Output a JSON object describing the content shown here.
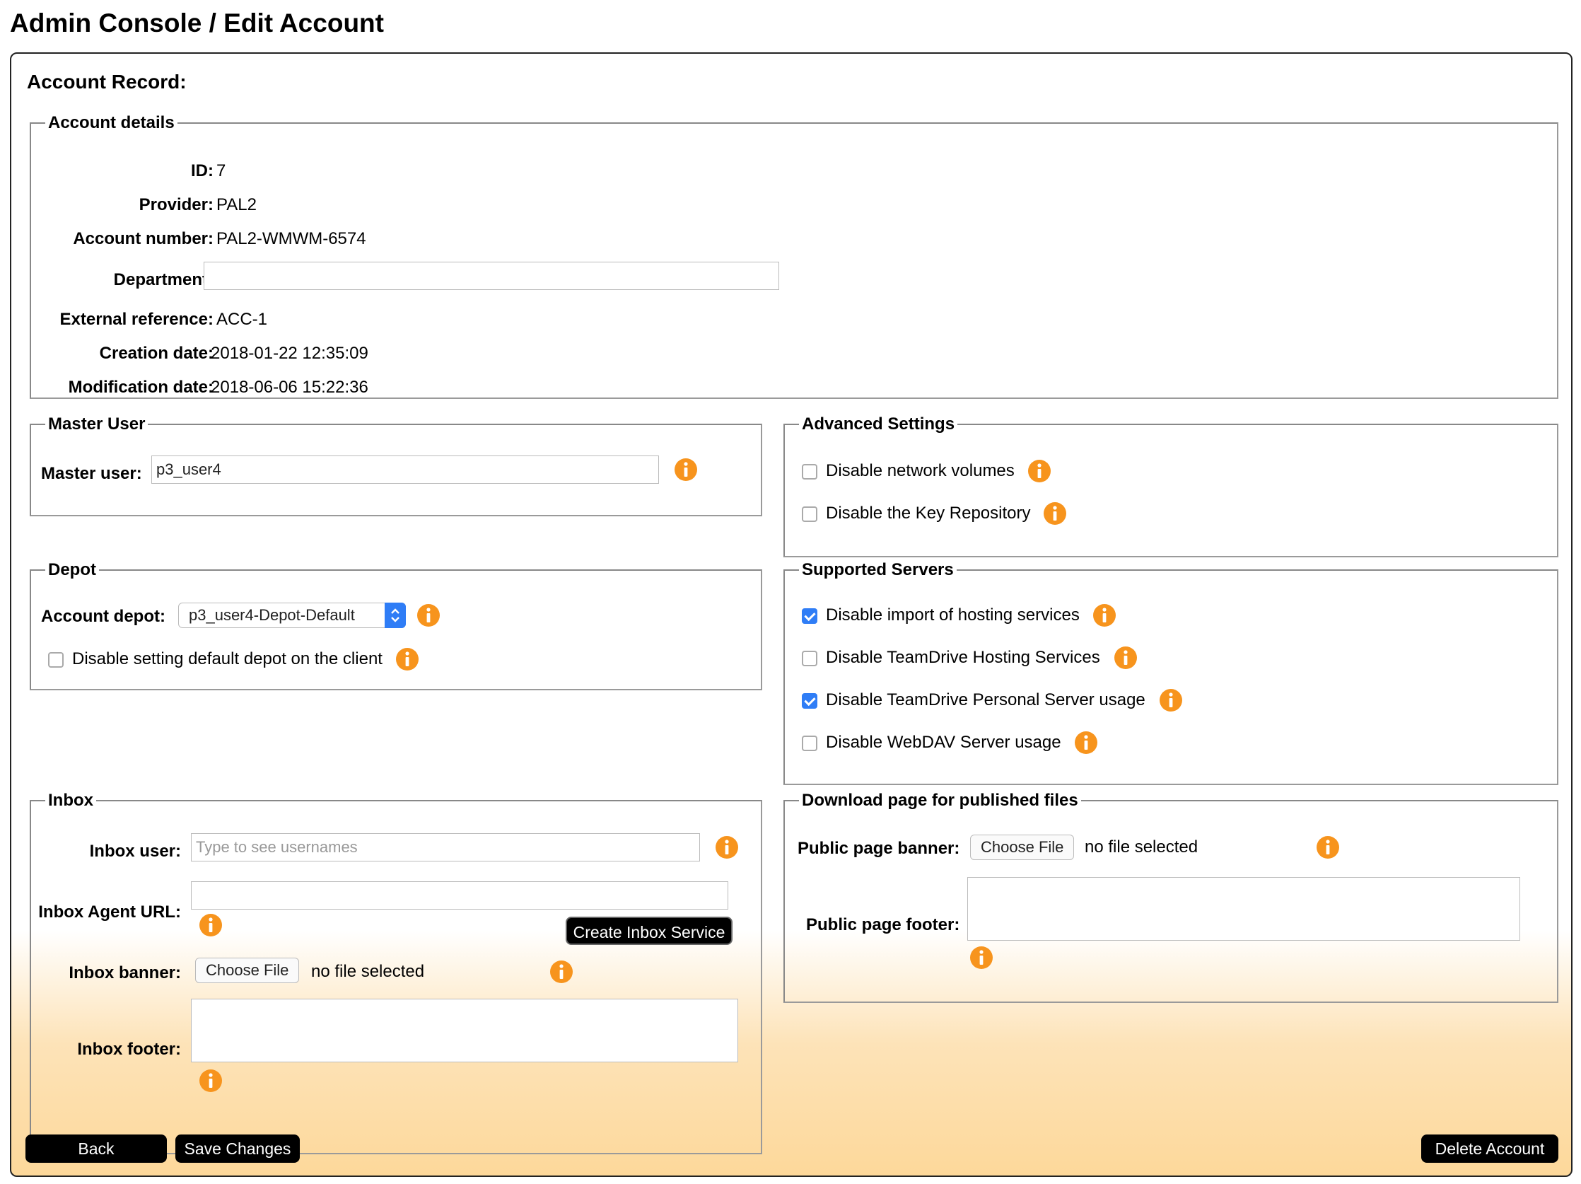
{
  "page": {
    "title": "Admin Console / Edit Account",
    "section_title": "Account Record:"
  },
  "account_details": {
    "legend": "Account details",
    "id_label": "ID:",
    "id": "7",
    "provider_label": "Provider:",
    "provider": "PAL2",
    "account_number_label": "Account number:",
    "account_number": "PAL2-WMWM-6574",
    "department_label": "Department:",
    "department": "",
    "external_reference_label": "External reference:",
    "external_reference": "ACC-1",
    "creation_date_label": "Creation date:",
    "creation_date": "2018-01-22 12:35:09",
    "modification_date_label": "Modification date:",
    "modification_date": "2018-06-06 15:22:36"
  },
  "master_user": {
    "legend": "Master User",
    "label": "Master user:",
    "value": "p3_user4"
  },
  "advanced_settings": {
    "legend": "Advanced Settings",
    "items": [
      {
        "label": "Disable network volumes",
        "checked": false
      },
      {
        "label": "Disable the Key Repository",
        "checked": false
      }
    ]
  },
  "depot": {
    "legend": "Depot",
    "label": "Account depot:",
    "selected": "p3_user4-Depot-Default",
    "checkbox_label": "Disable setting default depot on the client",
    "checkbox_checked": false
  },
  "supported_servers": {
    "legend": "Supported Servers",
    "items": [
      {
        "label": "Disable import of hosting services",
        "checked": true
      },
      {
        "label": "Disable TeamDrive Hosting Services",
        "checked": false
      },
      {
        "label": "Disable TeamDrive Personal Server usage",
        "checked": true
      },
      {
        "label": "Disable WebDAV Server usage",
        "checked": false
      }
    ]
  },
  "inbox": {
    "legend": "Inbox",
    "user_label": "Inbox user:",
    "user_placeholder": "Type to see usernames",
    "agent_url_label": "Inbox Agent URL:",
    "agent_url": "",
    "create_button": "Create Inbox Service",
    "banner_label": "Inbox banner:",
    "choose_file": "Choose File",
    "no_file": "no file selected",
    "footer_label": "Inbox footer:"
  },
  "download_page": {
    "legend": "Download page for published files",
    "banner_label": "Public page banner:",
    "choose_file": "Choose File",
    "no_file": "no file selected",
    "footer_label": "Public page footer:"
  },
  "buttons": {
    "back": "Back",
    "save": "Save Changes",
    "delete": "Delete Account"
  },
  "colors": {
    "info": "#f7941d",
    "checkbox_checked": "#2f7df6",
    "gradient_end": "#fdd89a"
  }
}
